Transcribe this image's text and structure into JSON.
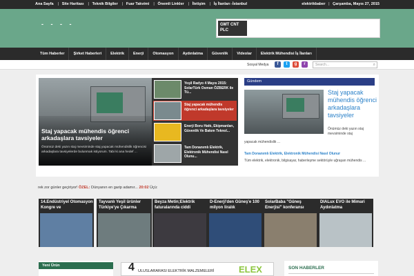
{
  "topbar": {
    "links": [
      "Ana Sayfa",
      "Site Haritası",
      "Teknik Bilgiler",
      "Fuar Takvimi",
      "Önemli Linkler",
      "İletişim",
      "İş İlanları -İstanbul"
    ],
    "username": "elektrikbaber",
    "date": "Çarşamba, Mayıs 27, 2015"
  },
  "header": {
    "logo_dots": "- - - -",
    "ad_badge": "GMT CNT PLC"
  },
  "nav": {
    "items": [
      "Tüm Haberler",
      "Şirket Haberleri",
      "Elektrik",
      "Enerji",
      "Otomasyon",
      "Aydınlatma",
      "Güvenlik",
      "Videolar",
      "Elektrik Mühendisi İş İlanları"
    ]
  },
  "social": {
    "label": "Sosyal Medya",
    "search_placeholder": "Search..."
  },
  "slider": {
    "caption": "Staj yapacak mühendis öğrenci arkadaşlara tavsiyeler",
    "desc": "Önümüz deki yazın staj mevsiminde staj yapacak mühendislik öğrencisi arkadaşlara tavsiyelerde bulunmak istiyorum. Tabi ki ana hedef ..."
  },
  "thumbs": [
    {
      "title": "Yeşil Radyo 4 Mayıs 2015: SolarTürk Osman ÖZBERK ile Tü..."
    },
    {
      "title": "Staj yapacak mühendis öğrenci arkadaşlara tavsiyeler"
    },
    {
      "title": "Enerji Boru Hattı, Ekipmanları, Güvenlik Ve Bakım Teknol..."
    },
    {
      "title": "Tam Donanımlı Elektrik, Elektronik Mühendisi Nasıl Olunu..."
    }
  ],
  "gundem": {
    "header": "Gündem",
    "title": "Staj yapacak mühendis öğrenci arkadaşlara tavsiyeler",
    "desc": "Önümüz deki yazın staj mevsiminde staj",
    "desc2": "yapacak mühendislik ...",
    "link": "Tam Donanımlı Elektrik, Elektronik Mühendisi Nasıl Olunur",
    "desc3": "Tüm elektrik, elektronik, bilgisayar, haberleşme sektörüyle uğraşan mühendis ..."
  },
  "ticker": {
    "text1": "rek zor günler geçiriyor!",
    "hl1": "ÖZEL:",
    "text2": "Dünyanın en garip adamır...",
    "hl2": "20:02",
    "text3": "Üçü:"
  },
  "cards": [
    {
      "title": "14.Endüstriyel Otomasyon Kongre ve"
    },
    {
      "title": "Tayvanlı Yeşil ürünler Türkiye'ye Çıkarma"
    },
    {
      "title": "Beyza Metin;Elektrik faturalarında ciddi"
    },
    {
      "title": "D-Enerji'den Güneş'e 100 milyon liralık"
    },
    {
      "title": "SolarBaba \"Güneş Enerjisi\" konferansı"
    },
    {
      "title": "DIALux EVO ile Mimari Aydınlatma"
    }
  ],
  "sidebar_left": {
    "header": "Yeni Ürün"
  },
  "banner": {
    "num": "4",
    "text": "ULUSLARARASI ELEKTRİK MALZEMELERİ",
    "brand": "ELEX"
  },
  "son_haberler": {
    "header": "SON HABERLER"
  },
  "colors": {
    "header_green": "#6aa78a",
    "nav_dark": "#2b2b2b",
    "accent_red": "#c0392b",
    "link_blue": "#2c82c9",
    "gundem_blue": "#2a3e86"
  }
}
